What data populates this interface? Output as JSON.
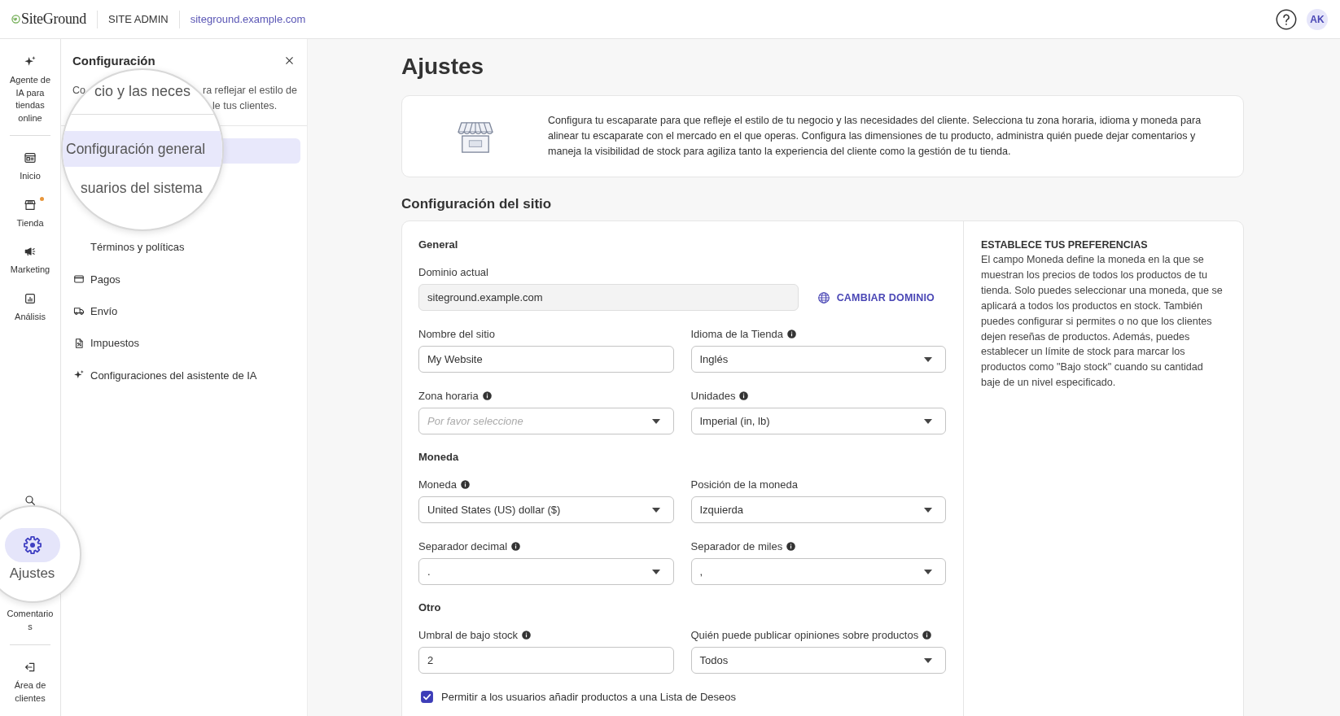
{
  "top_bar": {
    "logo_text": "SiteGround",
    "section_label": "SITE ADMIN",
    "site_link": "siteground.example.com",
    "avatar_initials": "AK"
  },
  "rail": {
    "top_groups": [
      [
        {
          "label": "Agente de IA para tiendas online",
          "selected": false,
          "badge": false,
          "magnified": false
        }
      ],
      [
        {
          "label": "Inicio",
          "selected": false,
          "badge": false,
          "magnified": false
        },
        {
          "label": "Tienda",
          "selected": false,
          "badge": true,
          "magnified": false
        },
        {
          "label": "Marketing",
          "selected": false,
          "badge": false,
          "magnified": false
        },
        {
          "label": "Análisis",
          "selected": false,
          "badge": false,
          "magnified": false
        }
      ]
    ],
    "bottom_groups": [
      [
        {
          "selected": false,
          "badge": false,
          "magnified": false
        },
        {
          "label": "Ajustes",
          "selected": true,
          "badge": false,
          "magnified": true
        },
        {
          "label": "Comentarios",
          "selected": false,
          "badge": false,
          "magnified": false
        }
      ],
      [
        {
          "label": "Área de clientes",
          "selected": false,
          "badge": false,
          "magnified": false
        }
      ]
    ]
  },
  "config_panel": {
    "title": "Configuración",
    "description": [
      {
        "left": "Co",
        "right": "ra reflejar el estilo de"
      },
      {
        "right": "le tus clientes."
      }
    ],
    "lens_text": "cio y las neces",
    "items": [
      {
        "label": "Configuración general",
        "selected": true,
        "magnified": true
      },
      {
        "label": "suarios del sistema",
        "selected": false,
        "magnified": true
      },
      {
        "label": "Términos y políticas",
        "selected": false,
        "magnified": false
      },
      {
        "label": "Pagos",
        "selected": false,
        "magnified": false
      },
      {
        "label": "Envío",
        "selected": false,
        "magnified": false
      },
      {
        "label": "Impuestos",
        "selected": false,
        "magnified": false
      },
      {
        "label": "Configuraciones del asistente de IA",
        "selected": false,
        "magnified": false
      }
    ]
  },
  "main": {
    "title": "Ajustes",
    "intro": "Configura tu escaparate para que refleje el estilo de tu negocio y las necesidades del cliente. Selecciona tu zona horaria, idioma y moneda para alinear tu escaparate con el mercado en el que operas. Configura las dimensiones de tu producto, administra quién puede dejar comentarios y maneja la visibilidad de stock para agiliza tanto la experiencia del cliente como la gestión de tu tienda.",
    "site_settings": {
      "title": "Configuración del sitio",
      "sections": [
        {
          "heading": "General",
          "fields": [
            {
              "kind": "readonly",
              "label": "Dominio actual",
              "info": false,
              "value": "siteground.example.com",
              "button": "CAMBIAR DOMINIO"
            },
            {
              "kind": "text",
              "label": "Nombre del sitio",
              "info": false,
              "value": "My Website"
            },
            {
              "kind": "select",
              "label": "Idioma de la Tienda",
              "info": true,
              "value": "Inglés"
            },
            {
              "kind": "select",
              "label": "Zona horaria",
              "info": true,
              "placeholder": "Por favor seleccione"
            },
            {
              "kind": "select",
              "label": "Unidades",
              "info": true,
              "value": "Imperial (in, lb)"
            }
          ]
        },
        {
          "heading": "Moneda",
          "fields": [
            {
              "kind": "select",
              "label": "Moneda",
              "info": true,
              "value": "United States (US) dollar ($)"
            },
            {
              "kind": "select",
              "label": "Posición de la moneda",
              "info": false,
              "value": "Izquierda"
            },
            {
              "kind": "select",
              "label": "Separador decimal",
              "info": true,
              "value": "."
            },
            {
              "kind": "select",
              "label": "Separador de miles",
              "info": true,
              "value": ","
            }
          ]
        },
        {
          "heading": "Otro",
          "fields": [
            {
              "kind": "text",
              "label": "Umbral de bajo stock",
              "info": true,
              "value": "2"
            },
            {
              "kind": "select",
              "label": "Quién puede publicar opiniones sobre productos",
              "info": true,
              "value": "Todos"
            },
            {
              "kind": "checkbox",
              "label": "Permitir a los usuarios añadir productos a una Lista de Deseos",
              "checked": true
            }
          ]
        }
      ],
      "aside": {
        "heading": "ESTABLECE TUS PREFERENCIAS",
        "text": "El campo Moneda define la moneda en la que se muestran los precios de todos los productos de tu tienda. Solo puedes seleccionar una moneda, que se aplicará a todos los productos en stock. También puedes configurar si permites o no que los clientes dejen reseñas de productos. Además, puedes establecer un límite de stock para marcar los productos como \"Bajo stock\" cuando su cantidad baje de un nivel especificado."
      }
    }
  }
}
